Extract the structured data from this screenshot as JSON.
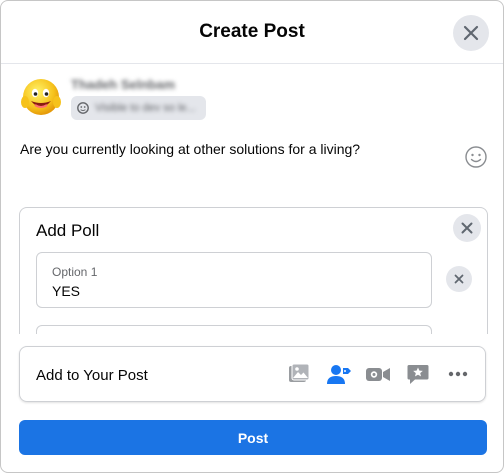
{
  "header": {
    "title": "Create Post",
    "close_icon": "close-icon"
  },
  "author": {
    "name": "Thadeh Selnbam",
    "audience": "Visible to dev so le...",
    "avatar_icon": "smiley-avatar-icon"
  },
  "composer": {
    "text": "Are you currently looking at other solutions for a living?",
    "emoji_icon": "emoji-icon"
  },
  "poll": {
    "title": "Add Poll",
    "options": [
      {
        "label": "Option 1",
        "value": "YES"
      }
    ]
  },
  "add_to_post": {
    "label": "Add to Your Post",
    "tools": [
      "photo-video-icon",
      "tag-people-icon",
      "live-video-icon",
      "feeling-activity-icon",
      "more-icon"
    ]
  },
  "post_button": {
    "label": "Post"
  },
  "colors": {
    "accent": "#1b74e4",
    "tag_blue": "#1877f2",
    "photo_green": "#45bd62",
    "live_red": "#f3425f",
    "feeling_yellow": "#f7b928",
    "gray_icon": "#65676b"
  }
}
